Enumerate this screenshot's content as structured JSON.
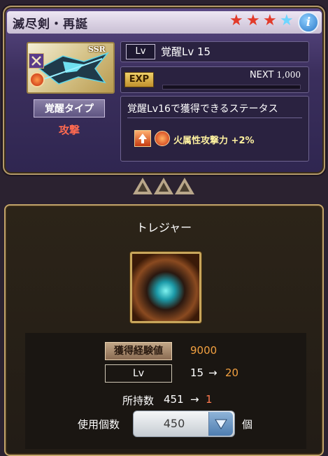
{
  "weapon": {
    "name": "滅尽剣・再誕",
    "rarity_badge": "SSR",
    "stars": [
      {
        "color": "#e23a2a",
        "glyph": "★"
      },
      {
        "color": "#e23a2a",
        "glyph": "★"
      },
      {
        "color": "#e23a2a",
        "glyph": "★"
      },
      {
        "color": "#6ed6ff",
        "glyph": "★"
      }
    ],
    "info_glyph": "i"
  },
  "awaken": {
    "type_label": "覚醒タイプ",
    "type_value": "攻撃"
  },
  "level": {
    "tag": "Lv",
    "text": "覚醒Lv 15"
  },
  "exp": {
    "tag": "EXP",
    "next_label": "NEXT",
    "next_value": "1,000",
    "progress": 0
  },
  "status": {
    "heading": "覚醒Lv16で獲得できるステータス",
    "skill_text": "火属性攻撃力",
    "skill_bonus": "+2%"
  },
  "treasure": {
    "title": "トレジャー",
    "gain_label": "獲得経験値",
    "gain_value": "9000",
    "lv_label": "Lv",
    "lv_from": "15",
    "lv_to": "20",
    "arrow": "→",
    "owned_label": "所持数",
    "owned_from": "451",
    "owned_to": "1",
    "use_label": "使用個数",
    "use_value": "450",
    "unit": "個"
  }
}
